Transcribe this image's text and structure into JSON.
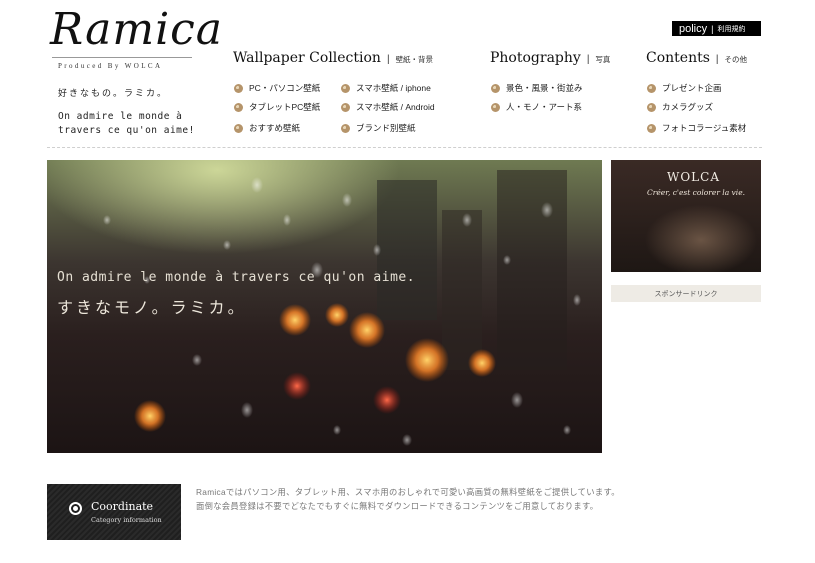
{
  "brand": {
    "logo": "Ramica",
    "produced_by": "Produced By WOLCA",
    "tagline_jp": "好きなもの。ラミカ。",
    "tagline_fr_line1": "On admire le monde à",
    "tagline_fr_line2": "travers ce qu'on aime!"
  },
  "policy": {
    "label": "policy",
    "separator": "|",
    "sub": "利用規約"
  },
  "nav": {
    "wallpaper": {
      "title": "Wallpaper Collection",
      "separator": "|",
      "sub": "壁紙・背景",
      "items": [
        {
          "label": "PC・パソコン壁紙"
        },
        {
          "label": "スマホ壁紙 / iphone"
        },
        {
          "label": "タブレットPC壁紙"
        },
        {
          "label": "スマホ壁紙 / Android"
        },
        {
          "label": "おすすめ壁紙"
        },
        {
          "label": "ブランド別壁紙"
        }
      ]
    },
    "photography": {
      "title": "Photography",
      "separator": "|",
      "sub": "写真",
      "items": [
        {
          "label": "景色・風景・街並み"
        },
        {
          "label": "人・モノ・アート系"
        }
      ]
    },
    "contents": {
      "title": "Contents",
      "separator": "|",
      "sub": "その他",
      "items": [
        {
          "label": "プレゼント企画"
        },
        {
          "label": "カメラグッズ"
        },
        {
          "label": "フォトコラージュ素材"
        }
      ]
    }
  },
  "hero": {
    "copy_fr": "On admire le monde à travers ce qu'on aime.",
    "copy_jp": "すきなモノ。ラミカ。"
  },
  "side_banner": {
    "title": "WOLCA",
    "subtitle": "Créer, c'est colorer la vie."
  },
  "sponsor": {
    "label": "スポンサードリンク"
  },
  "coordinate": {
    "title": "Coordinate",
    "subtitle": "Category information"
  },
  "description": {
    "line1": "Ramicaではパソコン用、タブレット用、スマホ用のおしゃれで可愛い高画質の無料壁紙をご提供しています。",
    "line2": "面倒な会員登録は不要でどなたでもすぐに無料でダウンロードできるコンテンツをご用意しております。"
  },
  "colors": {
    "accent_bullet": "#b5946a",
    "text_dark": "#222222",
    "text_muted": "#777777",
    "policy_bg": "#000000"
  }
}
